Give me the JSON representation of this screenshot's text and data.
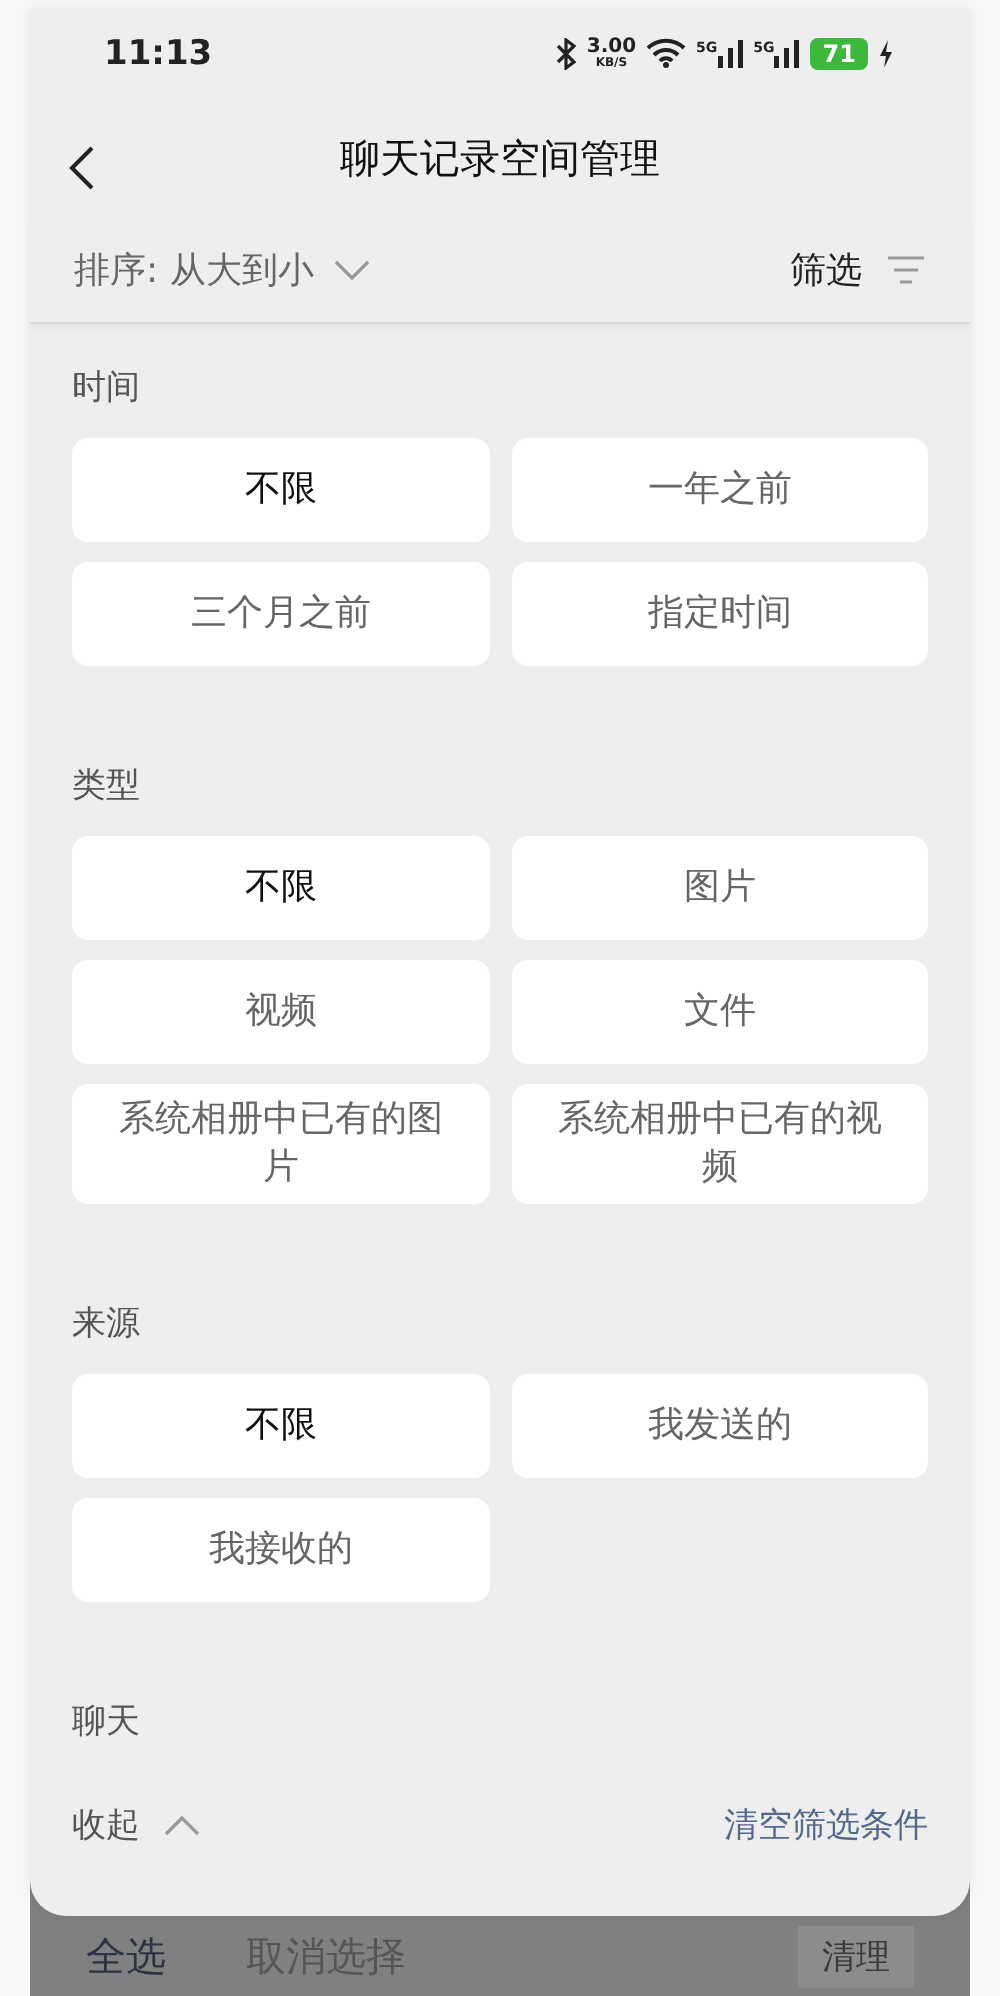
{
  "status_bar": {
    "time": "11:13",
    "speed_value": "3.00",
    "speed_unit": "KB/S",
    "sims": [
      "5G",
      "5G"
    ],
    "battery": "71"
  },
  "header": {
    "title": "聊天记录空间管理"
  },
  "toolbar": {
    "sort_label": "排序: 从大到小",
    "filter_label": "筛选"
  },
  "sections": [
    {
      "title": "时间",
      "options": [
        {
          "label": "不限",
          "selected": true
        },
        {
          "label": "一年之前",
          "selected": false
        },
        {
          "label": "三个月之前",
          "selected": false
        },
        {
          "label": "指定时间",
          "selected": false
        }
      ]
    },
    {
      "title": "类型",
      "options": [
        {
          "label": "不限",
          "selected": true
        },
        {
          "label": "图片",
          "selected": false
        },
        {
          "label": "视频",
          "selected": false
        },
        {
          "label": "文件",
          "selected": false
        },
        {
          "label": "系统相册中已有的图片",
          "selected": false
        },
        {
          "label": "系统相册中已有的视频",
          "selected": false
        }
      ]
    },
    {
      "title": "来源",
      "options": [
        {
          "label": "不限",
          "selected": true
        },
        {
          "label": "我发送的",
          "selected": false
        },
        {
          "label": "我接收的",
          "selected": false
        }
      ]
    },
    {
      "title": "聊天"
    }
  ],
  "panel_footer": {
    "collapse": "收起",
    "clear": "清空筛选条件"
  },
  "bottom_bar": {
    "select_all": "全选",
    "deselect": "取消选择",
    "clean": "清理"
  }
}
